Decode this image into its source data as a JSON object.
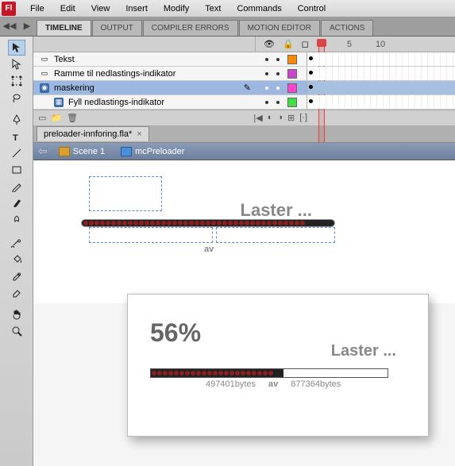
{
  "app": {
    "logo": "Fl"
  },
  "menu": [
    "File",
    "Edit",
    "View",
    "Insert",
    "Modify",
    "Text",
    "Commands",
    "Control"
  ],
  "panels": {
    "tabs": [
      {
        "label": "TIMELINE",
        "active": true
      },
      {
        "label": "OUTPUT"
      },
      {
        "label": "COMPILER ERRORS"
      },
      {
        "label": "MOTION EDITOR"
      },
      {
        "label": "ACTIONS"
      }
    ]
  },
  "timeline": {
    "ruler": {
      "marks": [
        "5",
        "10"
      ]
    },
    "layers": [
      {
        "name": "Tekst",
        "color": "#ff8800",
        "selected": false,
        "indent": 0
      },
      {
        "name": "Ramme til nedlastings-indikator",
        "color": "#cc44cc",
        "selected": false,
        "indent": 0
      },
      {
        "name": "maskering",
        "color": "#ff44cc",
        "selected": true,
        "indent": 0,
        "editing": true
      },
      {
        "name": "Fyll nedlastings-indikator",
        "color": "#44dd44",
        "selected": false,
        "indent": 1
      }
    ]
  },
  "document": {
    "tab": "preloader-innforing.fla*"
  },
  "breadcrumb": {
    "items": [
      {
        "label": "Scene 1",
        "type": "scene"
      },
      {
        "label": "mcPreloader",
        "type": "symbol"
      }
    ]
  },
  "stage": {
    "loading_label": "Laster ...",
    "separator": "av"
  },
  "preview": {
    "percent": "56%",
    "loading_label": "Laster ...",
    "bytes_loaded": "497401bytes",
    "separator": "av",
    "bytes_total": "877364bytes"
  }
}
